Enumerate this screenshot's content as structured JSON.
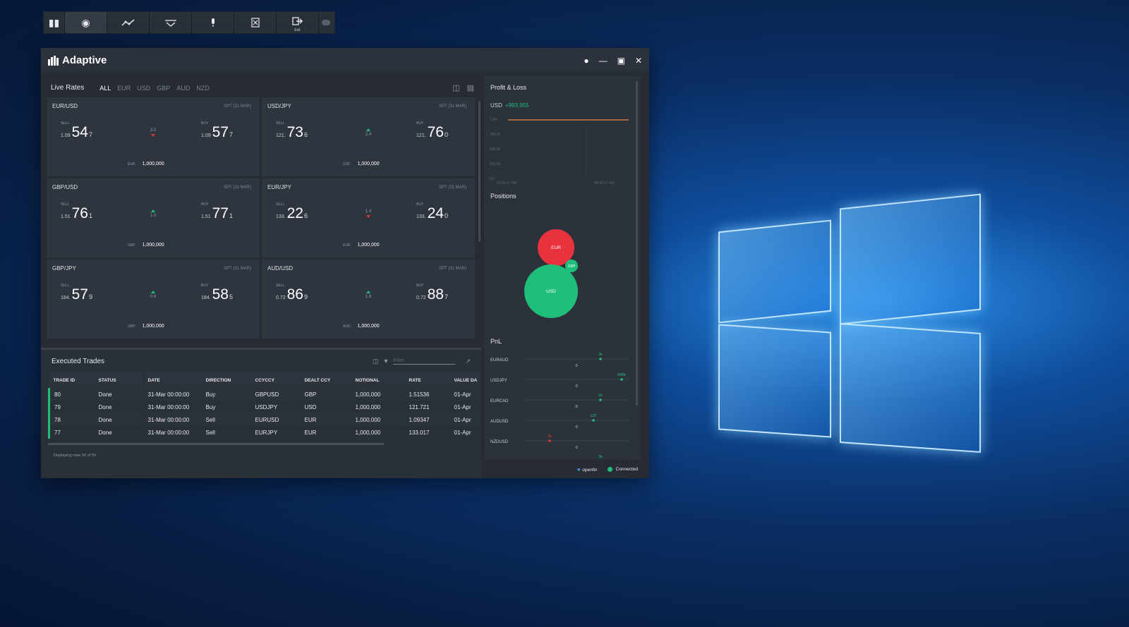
{
  "launcher": {
    "buttons": [
      "bar-chart-icon",
      "coins-icon",
      "line-chart-icon",
      "filter-chart-icon",
      "microphone-icon",
      "excel-icon",
      "exit-icon"
    ],
    "exit_label": "Exit"
  },
  "window": {
    "title": "Adaptive"
  },
  "live_rates": {
    "title": "Live Rates",
    "filters": [
      "ALL",
      "EUR",
      "USD",
      "GBP",
      "AUD",
      "NZD"
    ],
    "active_filter": "ALL",
    "tiles": [
      {
        "pair": "EUR/USD",
        "spt": "SPT (31 MAR)",
        "sell_label": "SELL",
        "sell_big": "1.09",
        "sell_pips": "54",
        "sell_frac": "7",
        "spread": "3.0",
        "direction": "down",
        "buy_label": "BUY",
        "buy_big": "1.09",
        "buy_pips": "57",
        "buy_frac": "7",
        "notional_ccy": "EUR",
        "notional": "1,000,000"
      },
      {
        "pair": "USD/JPY",
        "spt": "SPT (31 MAR)",
        "sell_label": "SELL",
        "sell_big": "121.",
        "sell_pips": "73",
        "sell_frac": "6",
        "spread": "2.4",
        "direction": "up",
        "buy_label": "BUY",
        "buy_big": "121.",
        "buy_pips": "76",
        "buy_frac": "0",
        "notional_ccy": "USD",
        "notional": "1,000,000"
      },
      {
        "pair": "GBP/USD",
        "spt": "SPT (31 MAR)",
        "sell_label": "SELL",
        "sell_big": "1.51",
        "sell_pips": "76",
        "sell_frac": "1",
        "spread": "1.0",
        "direction": "up",
        "buy_label": "BUY",
        "buy_big": "1.51",
        "buy_pips": "77",
        "buy_frac": "1",
        "notional_ccy": "GBP",
        "notional": "1,000,000"
      },
      {
        "pair": "EUR/JPY",
        "spt": "SPT (31 MAR)",
        "sell_label": "SELL",
        "sell_big": "133.",
        "sell_pips": "22",
        "sell_frac": "6",
        "spread": "1.4",
        "direction": "down",
        "buy_label": "BUY",
        "buy_big": "133.",
        "buy_pips": "24",
        "buy_frac": "0",
        "notional_ccy": "EUR",
        "notional": "1,000,000"
      },
      {
        "pair": "GBP/JPY",
        "spt": "SPT (31 MAR)",
        "sell_label": "SELL",
        "sell_big": "184.",
        "sell_pips": "57",
        "sell_frac": "9",
        "spread": "0.6",
        "direction": "up",
        "buy_label": "BUY",
        "buy_big": "184.",
        "buy_pips": "58",
        "buy_frac": "5",
        "notional_ccy": "GBP",
        "notional": "1,000,000"
      },
      {
        "pair": "AUD/USD",
        "spt": "SPT (31 MAR)",
        "sell_label": "SELL",
        "sell_big": "0.72",
        "sell_pips": "86",
        "sell_frac": "9",
        "spread": "1.8",
        "direction": "up",
        "buy_label": "BUY",
        "buy_big": "0.72",
        "buy_pips": "88",
        "buy_frac": "7",
        "notional_ccy": "AUD",
        "notional": "1,000,000"
      }
    ]
  },
  "trades": {
    "title": "Executed Trades",
    "filter_placeholder": "Filter",
    "columns": [
      "TRADE ID",
      "STATUS",
      "DATE",
      "DIRECTION",
      "CCYCCY",
      "DEALT CCY",
      "NOTIONAL",
      "RATE",
      "VALUE DA"
    ],
    "rows": [
      [
        "80",
        "Done",
        "31-Mar 00:00:00",
        "Buy",
        "GBPUSD",
        "GBP",
        "1,000,000",
        "1.51536",
        "01-Apr"
      ],
      [
        "79",
        "Done",
        "31-Mar 00:00:00",
        "Buy",
        "USDJPY",
        "USD",
        "1,000,000",
        "121.721",
        "01-Apr"
      ],
      [
        "78",
        "Done",
        "31-Mar 00:00:00",
        "Sell",
        "EURUSD",
        "EUR",
        "1,000,000",
        "1.09347",
        "01-Apr"
      ],
      [
        "77",
        "Done",
        "31-Mar 00:00:00",
        "Sell",
        "EURJPY",
        "EUR",
        "1,000,000",
        "133.017",
        "01-Apr"
      ]
    ],
    "footer": "Displaying rows 50 of 50"
  },
  "analytics": {
    "pnl_title": "Profit & Loss",
    "pnl_ccy": "USD",
    "pnl_value": "+993,955",
    "pnl_axis": [
      "1.0m",
      "750.0k",
      "500.0k",
      "250.0k",
      "0.0"
    ],
    "pnl_times": [
      "03:55:47 PM",
      "04:10:17 PM"
    ],
    "positions_title": "Positions",
    "positions": [
      {
        "ccy": "EUR",
        "color": "#e8323e",
        "size": "medium"
      },
      {
        "ccy": "GBP",
        "color": "#1fbf7b",
        "size": "small"
      },
      {
        "ccy": "USD",
        "color": "#1fbf7b",
        "size": "large"
      }
    ],
    "pnl_bars_title": "PnL",
    "pnl_bars": [
      {
        "pair": "EURAUD",
        "value_label": "2k",
        "positive": true,
        "zero": "0"
      },
      {
        "pair": "USDJPY",
        "value_label": "999k",
        "positive": true,
        "zero": "0"
      },
      {
        "pair": "EURCAD",
        "value_label": "1k",
        "positive": true,
        "zero": "0"
      },
      {
        "pair": "AUDUSD",
        "value_label": "137",
        "positive": true,
        "zero": "0"
      },
      {
        "pair": "NZDUSD",
        "value_label": "3k",
        "positive": false,
        "zero": "0"
      },
      {
        "pair": "",
        "value_label": "3k",
        "positive": true,
        "zero": ""
      }
    ]
  },
  "footer": {
    "openfin": "openfin",
    "status": "Connected"
  },
  "colors": {
    "positive": "#1fbf7b",
    "negative": "#e8323e",
    "accent_blue": "#2a8ee8"
  }
}
